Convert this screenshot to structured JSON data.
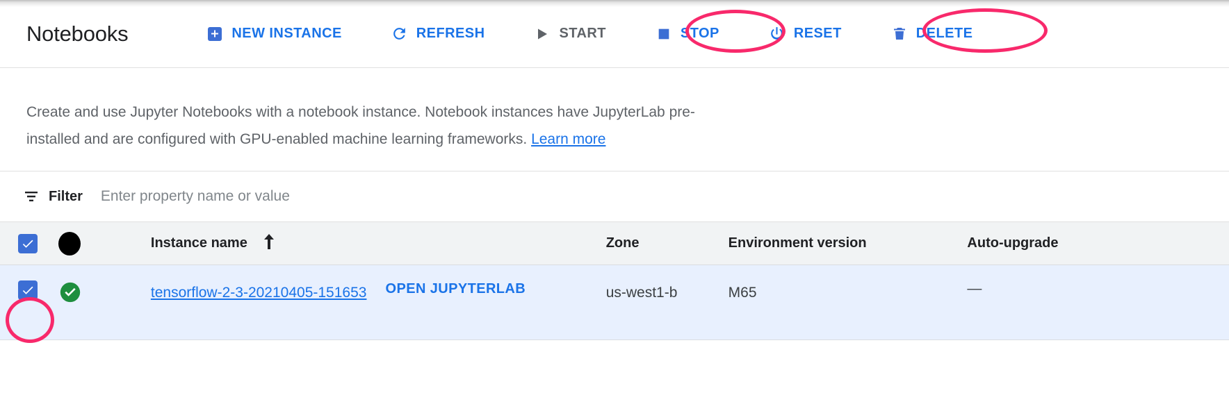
{
  "header": {
    "title": "Notebooks",
    "actions": [
      {
        "id": "new-instance",
        "label": "NEW INSTANCE",
        "icon": "plus-box-icon",
        "state": "enabled"
      },
      {
        "id": "refresh",
        "label": "REFRESH",
        "icon": "refresh-icon",
        "state": "enabled"
      },
      {
        "id": "start",
        "label": "START",
        "icon": "play-icon",
        "state": "disabled"
      },
      {
        "id": "stop",
        "label": "STOP",
        "icon": "stop-square-icon",
        "state": "enabled"
      },
      {
        "id": "reset",
        "label": "RESET",
        "icon": "power-icon",
        "state": "enabled"
      },
      {
        "id": "delete",
        "label": "DELETE",
        "icon": "trash-icon",
        "state": "enabled"
      }
    ]
  },
  "description": {
    "text_before_link": "Create and use Jupyter Notebooks with a notebook instance. Notebook instances have JupyterLab pre-installed and are configured with GPU-enabled machine learning frameworks. ",
    "link_label": "Learn more"
  },
  "filter": {
    "icon": "filter-icon",
    "label": "Filter",
    "value": "",
    "placeholder": "Enter property name or value"
  },
  "table": {
    "columns": [
      {
        "id": "select",
        "label": "",
        "type": "checkbox"
      },
      {
        "id": "status",
        "label": "",
        "type": "status"
      },
      {
        "id": "name",
        "label": "Instance name",
        "type": "link",
        "sorted": true,
        "sort_direction": "ascending",
        "sort_icon": "arrow-up-icon"
      },
      {
        "id": "open",
        "label": "",
        "type": "action"
      },
      {
        "id": "zone",
        "label": "Zone",
        "type": "text"
      },
      {
        "id": "environment",
        "label": "Environment version",
        "type": "text"
      },
      {
        "id": "autoupgrade",
        "label": "Auto-upgrade",
        "type": "text"
      }
    ],
    "header_select_all_checked": true,
    "header_status_icon": "filled-circle-icon",
    "rows": [
      {
        "selected": true,
        "status_icon": "check-circle-icon",
        "status_color": "#1e8e3e",
        "name": "tensorflow-2-3-20210405-151653",
        "open_label": "OPEN JUPYTERLAB",
        "zone": "us-west1-b",
        "environment": "M65",
        "autoupgrade": "—"
      }
    ]
  },
  "annotations": {
    "color": "#f8296b",
    "targets": [
      "stop-button",
      "delete-button",
      "row-select-checkbox"
    ]
  },
  "colors": {
    "accent_blue": "#1a73e8",
    "checkbox_blue": "#3c6ed4",
    "status_green": "#1e8e3e",
    "header_bg": "#f1f3f4",
    "selected_row_bg": "#e8f0fe",
    "text_primary": "#202124",
    "text_secondary": "#5f6368",
    "annotation_pink": "#f8296b"
  }
}
